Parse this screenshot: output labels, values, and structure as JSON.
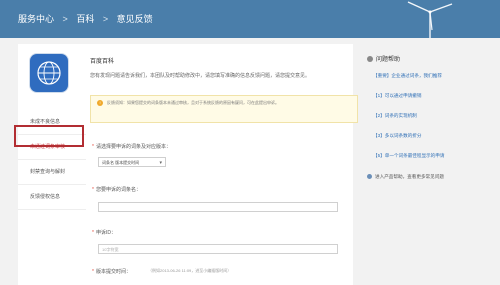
{
  "breadcrumb": {
    "items": [
      "服务中心",
      "百科",
      "意见反馈"
    ],
    "separator": ">"
  },
  "product": {
    "title": "百度百科",
    "description": "您有发现问题请告诉我们，本团队及时帮助修改中，请您填写准确的信息反馈问题，请您提交意见。"
  },
  "sidebar": {
    "items": [
      {
        "label": "未成不良信息"
      },
      {
        "label": "未通过词条审核",
        "active": true
      },
      {
        "label": "封禁查询与解封"
      },
      {
        "label": "反馈侵权信息"
      }
    ]
  },
  "notice": {
    "text": "反馈须知：如果您提交的词条版本未通过审核，且对于系统反馈的原因有疑问，可在此提出申诉。"
  },
  "form": {
    "q1_label": "请选择要申诉的词条及对应版本：",
    "select_value": "词条名  版本提交时间",
    "q2_label": "您要申诉的词条名：",
    "q3_label": "申诉ID：",
    "q3_placeholder": "10字符宽",
    "q4_label": "版本提交时间：",
    "q4_hint": "（例如2013-06-26 11:09，进至小编插版时间）"
  },
  "help": {
    "title": "问题帮助",
    "links": [
      "【重要】企业通过词条，我们推荐",
      "【1】可以通过申请撤销",
      "【2】词条的实现机制",
      "【3】多以词条数的折分",
      "【5】单一个词条最佳程显示的申请"
    ],
    "footer": "进入产品帮助，查看更多常见问题"
  },
  "colors": {
    "banner": "#4a7eaa",
    "highlight": "#b22d32",
    "link": "#2f6fb6",
    "logo": "#2f6cbf"
  }
}
